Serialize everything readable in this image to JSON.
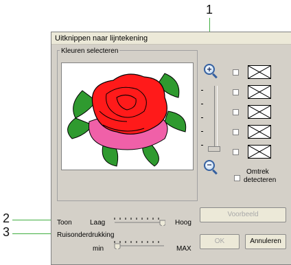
{
  "callouts": {
    "c1": "1",
    "c2": "2",
    "c3": "3"
  },
  "dialog": {
    "title": "Uitknippen naar lijntekening",
    "group_label": "Kleuren selecteren",
    "zoom_in_icon": "zoom-in-magnifier",
    "zoom_out_icon": "zoom-out-magnifier",
    "outline": {
      "label_line1": "Omtrek",
      "label_line2": "detecteren"
    },
    "tone": {
      "label": "Toon",
      "low": "Laag",
      "high": "Hoog",
      "value_fraction": 0.95
    },
    "noise": {
      "label": "Ruisonderdrukking",
      "min": "min",
      "max": "MAX",
      "value_fraction": 0.0
    },
    "buttons": {
      "preview": "Voorbeeld",
      "ok": "OK",
      "cancel": "Annuleren"
    },
    "colors": {
      "accent": "#3fae3f",
      "rose_red": "#ff1a1a",
      "rose_pink": "#f060a8",
      "leaf": "#2f9a2f"
    }
  }
}
